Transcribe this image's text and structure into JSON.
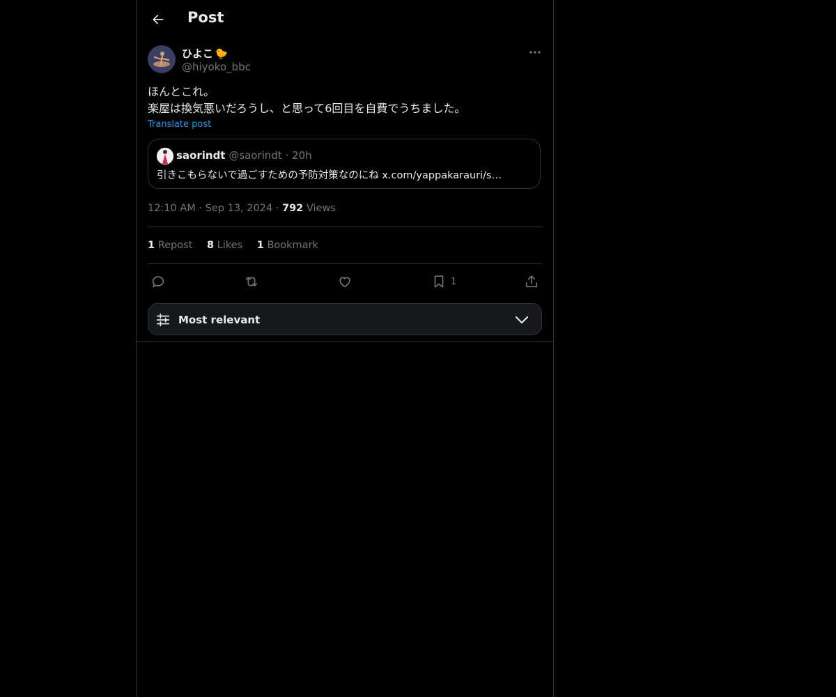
{
  "header": {
    "title": "Post"
  },
  "post": {
    "author_name": "ひよこ",
    "author_emoji": "🐤",
    "author_handle": "@hiyoko_bbc",
    "text_line1": "ほんとこれ。",
    "text_line2": "楽屋は換気悪いだろうし、と思って6回目を自費でうちました。",
    "translate_label": "Translate post",
    "quote": {
      "name": "saorindt",
      "handle": "@saorindt",
      "separator": "·",
      "age": "20h",
      "text": "引きこもらないで過ごすための予防対策なのにね x.com/yappakarauri/s…"
    },
    "time": "12:10 AM",
    "dot": "·",
    "date": "Sep 13, 2024",
    "views_count": "792",
    "views_label": "Views"
  },
  "stats": {
    "reposts_count": "1",
    "reposts_label": "Repost",
    "likes_count": "8",
    "likes_label": "Likes",
    "bookmarks_count": "1",
    "bookmarks_label": "Bookmark"
  },
  "actions": {
    "bookmark_count": "1"
  },
  "sort": {
    "label": "Most relevant"
  },
  "icons": {
    "back": "arrow-left-icon",
    "more": "more-horizontal-icon",
    "reply": "reply-icon",
    "repost": "repost-icon",
    "like": "heart-icon",
    "bookmark": "bookmark-icon",
    "share": "share-icon",
    "sort": "sliders-icon",
    "chevron": "chevron-down-icon"
  },
  "colors": {
    "background": "#000000",
    "accent": "#1d9bf0",
    "text": "#e7e9ea",
    "muted": "#71767b",
    "border": "#2f3336"
  }
}
